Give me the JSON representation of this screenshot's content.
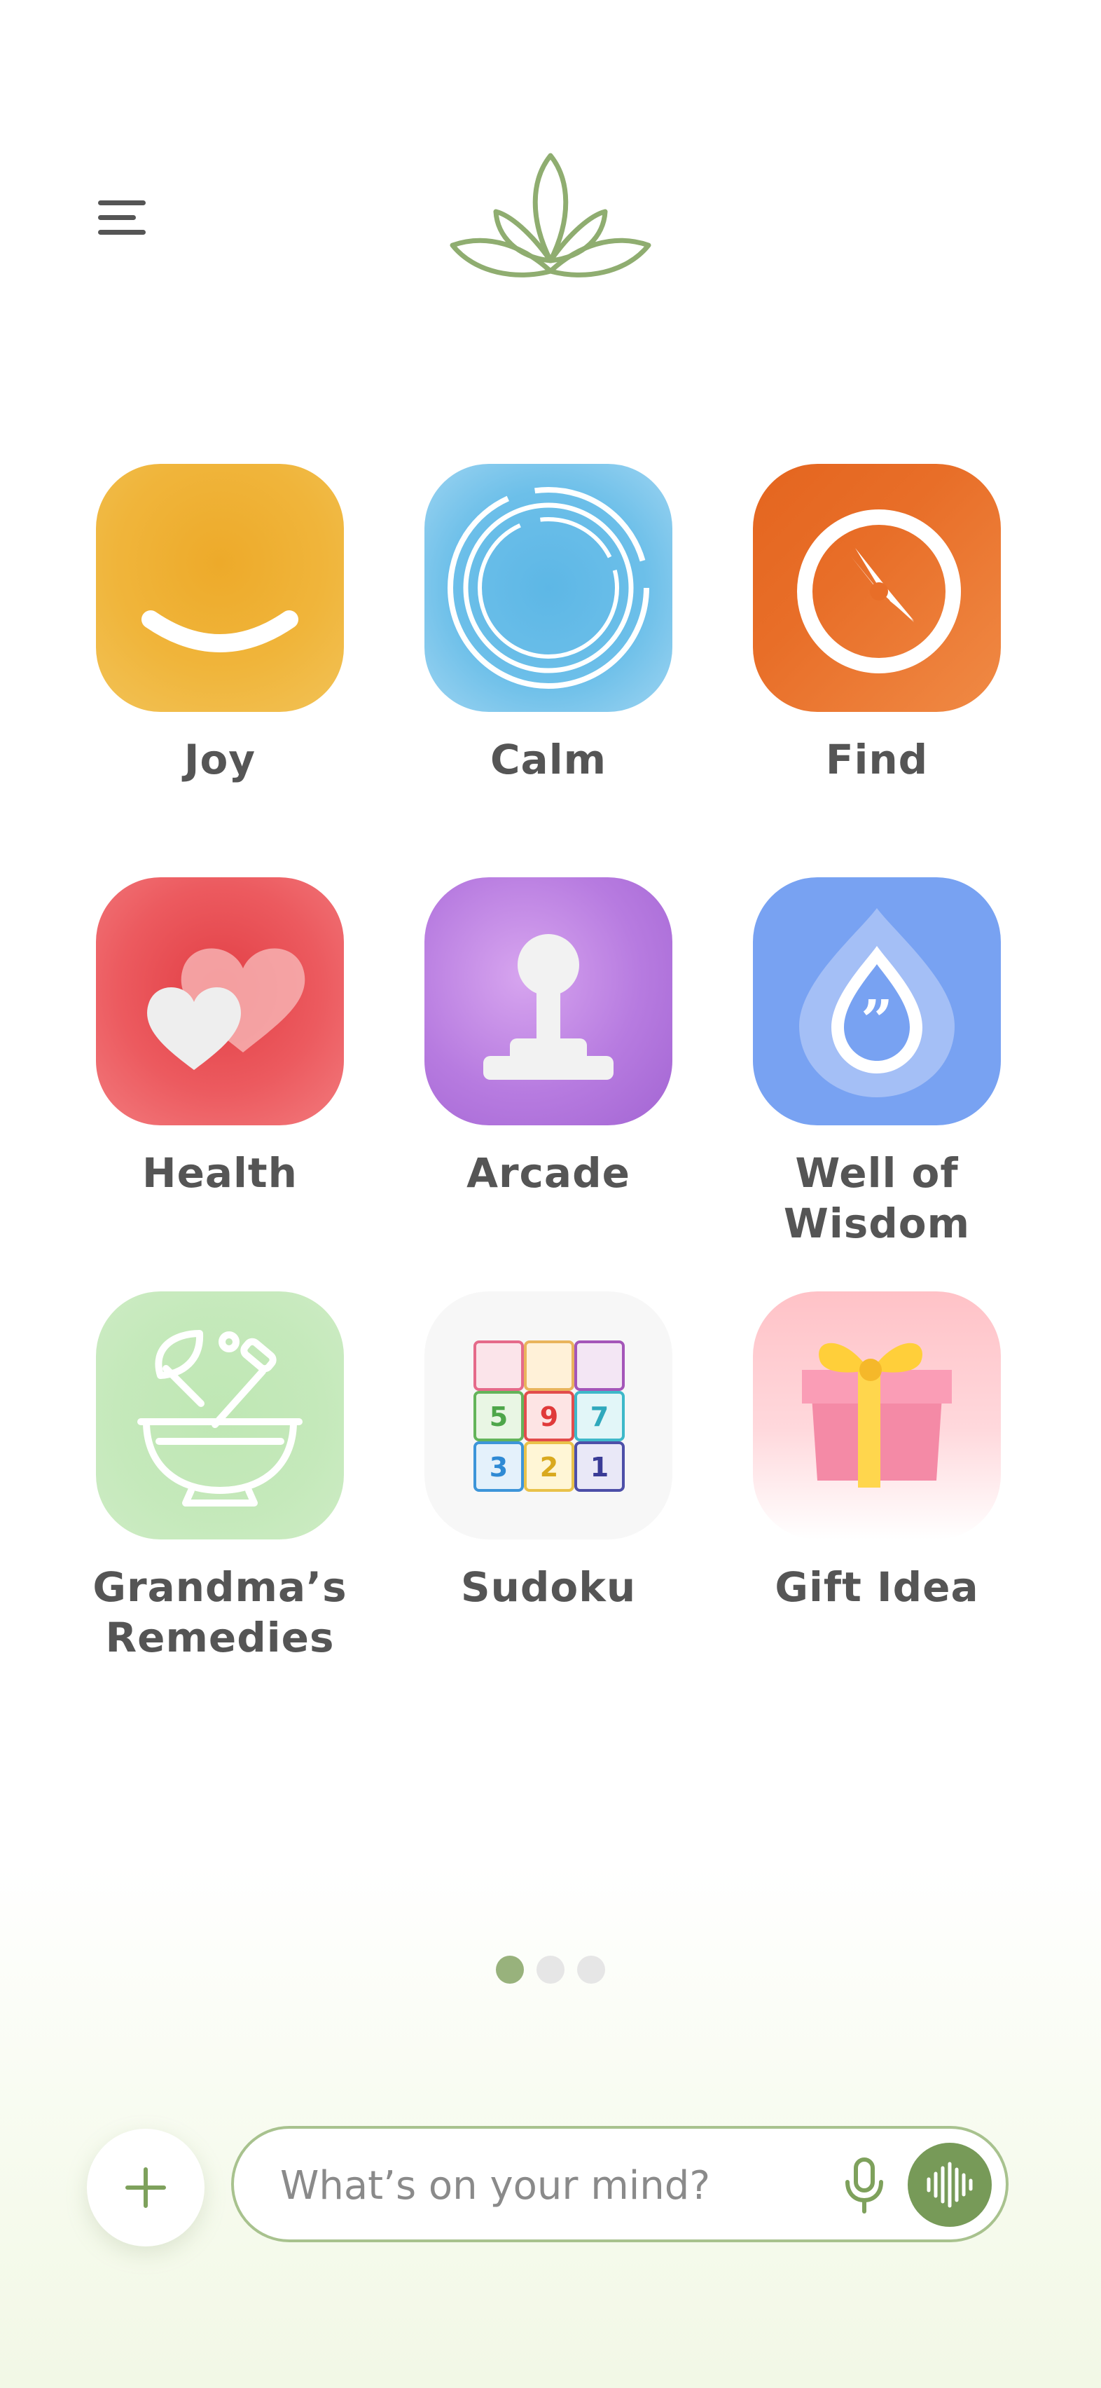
{
  "header": {
    "menu_icon": "hamburger-menu-icon",
    "logo_icon": "lotus-logo-icon",
    "accent_color": "#8fad70"
  },
  "apps": [
    {
      "label": "Joy",
      "icon": "smile-icon",
      "color": "#f0b53b"
    },
    {
      "label": "Calm",
      "icon": "breathing-rings-icon",
      "color": "#6cbfe9"
    },
    {
      "label": "Find",
      "icon": "compass-icon",
      "color": "#e86e28"
    },
    {
      "label": "Health",
      "icon": "hearts-icon",
      "color": "#ec5a5f"
    },
    {
      "label": "Arcade",
      "icon": "joystick-icon",
      "color": "#b77be0"
    },
    {
      "label": "Well of\nWisdom",
      "icon": "quote-drop-icon",
      "color": "#78a2f2"
    },
    {
      "label": "Grandma’s\nRemedies",
      "icon": "mortar-pestle-icon",
      "color": "#c5e9bb"
    },
    {
      "label": "Sudoku",
      "icon": "sudoku-grid-icon",
      "color": "#f7f7f7",
      "grid": [
        "",
        "",
        "",
        "5",
        "9",
        "7",
        "3",
        "2",
        "1"
      ]
    },
    {
      "label": "Gift Idea",
      "icon": "gift-box-icon",
      "color": "#ffc2c7"
    }
  ],
  "pager": {
    "pages": 3,
    "active": 0
  },
  "chat": {
    "placeholder": "What’s on your mind?",
    "add_icon": "plus-icon",
    "mic_icon": "microphone-icon",
    "voice_icon": "voice-waveform-icon",
    "voice_color": "#779a58"
  }
}
